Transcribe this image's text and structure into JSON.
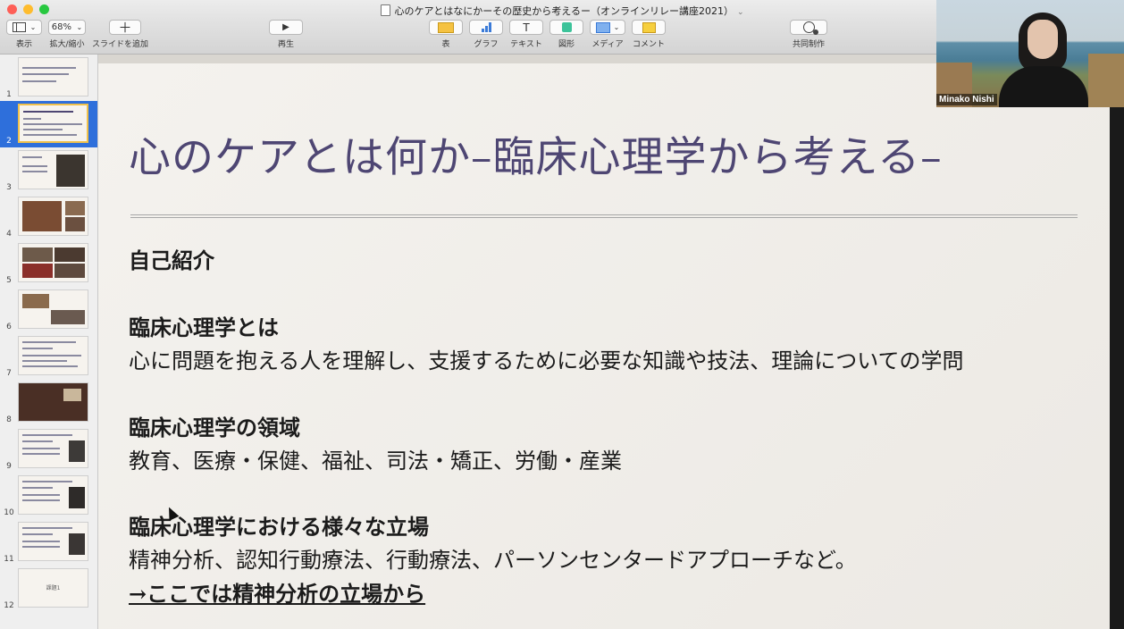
{
  "window": {
    "title": "心のケアとはなにかーその歴史から考えるー（オンラインリレー講座2021）",
    "title_icon": "keynote-doc-icon"
  },
  "toolbar": {
    "view_label": "表示",
    "zoom_value": "68%",
    "zoom_label": "拡大/縮小",
    "add_slide_label": "スライドを追加",
    "play_label": "再生",
    "table_label": "表",
    "chart_label": "グラフ",
    "text_label": "テキスト",
    "shape_label": "図形",
    "media_label": "メディア",
    "comment_label": "コメント",
    "collab_label": "共同制作"
  },
  "sidebar": {
    "selected": "2",
    "slides": [
      {
        "num": "1"
      },
      {
        "num": "2"
      },
      {
        "num": "3"
      },
      {
        "num": "4"
      },
      {
        "num": "5"
      },
      {
        "num": "6"
      },
      {
        "num": "7"
      },
      {
        "num": "8"
      },
      {
        "num": "9"
      },
      {
        "num": "10"
      },
      {
        "num": "11"
      },
      {
        "num": "12",
        "text": "課題1"
      }
    ]
  },
  "slide": {
    "title": "心のケアとは何か–臨床心理学から考える–",
    "self_intro": "自己紹介",
    "h1": "臨床心理学とは",
    "p1": "心に問題を抱える人を理解し、支援するために必要な知識や技法、理論についての学問",
    "h2": "臨床心理学の領域",
    "p2": "教育、医療・保健、福祉、司法・矯正、労働・産業",
    "h3": "臨床心理学における様々な立場",
    "p3": "精神分析、認知行動療法、行動療法、パーソンセンタードアプローチなど。",
    "p4": "→ここでは精神分析の立場から"
  },
  "video": {
    "name": "Minako Nishi"
  },
  "colors": {
    "title": "#4e4673",
    "selection": "#2e6fdb",
    "slide_bg": "#f4f2ee"
  }
}
